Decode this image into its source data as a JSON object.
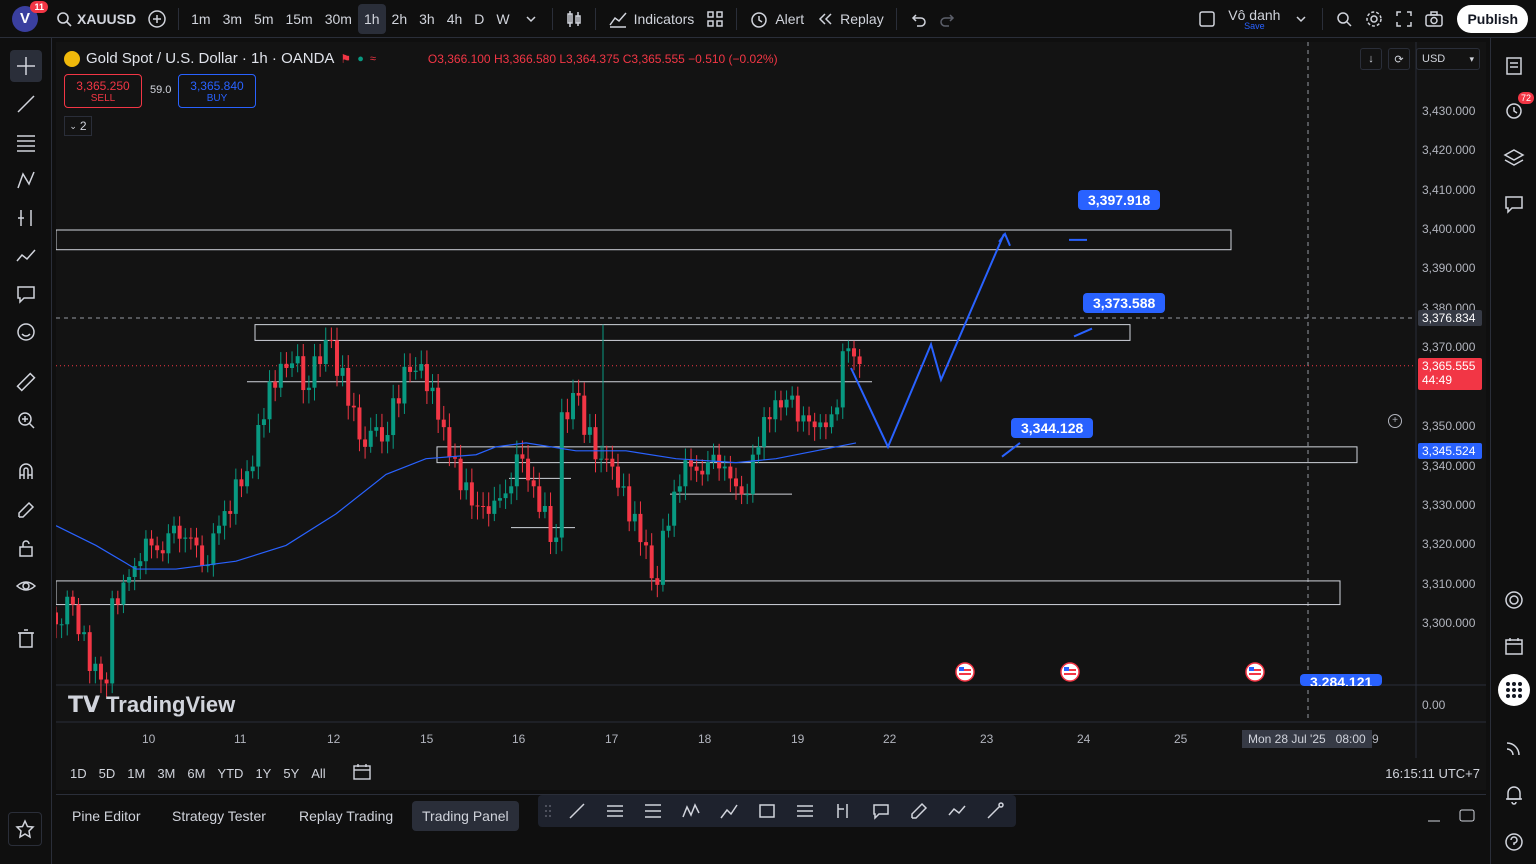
{
  "topbar": {
    "avatar_letter": "V",
    "avatar_badge": "11",
    "symbol": "XAUUSD",
    "timeframes": [
      "1m",
      "3m",
      "5m",
      "15m",
      "30m",
      "1h",
      "2h",
      "3h",
      "4h",
      "D",
      "W"
    ],
    "active_timeframe": "1h",
    "indicators_label": "Indicators",
    "alert_label": "Alert",
    "replay_label": "Replay",
    "layout_name": "Vô danh",
    "layout_status": "Save",
    "publish_label": "Publish"
  },
  "legend": {
    "title": "Gold Spot / U.S. Dollar · 1h · OANDA",
    "open": "O3,366.100",
    "high": "H3,366.580",
    "low": "L3,364.375",
    "close": "C3,365.555",
    "change": "−0.510 (−0.02%)",
    "sell_price": "3,365.250",
    "sell_label": "SELL",
    "buy_price": "3,365.840",
    "buy_label": "BUY",
    "spread": "59.0",
    "collapse_count": "2"
  },
  "price_scale": {
    "currency": "USD",
    "ticks": [
      "3,430.000",
      "3,420.000",
      "3,410.000",
      "3,400.000",
      "3,390.000",
      "3,380.000",
      "3,370.000",
      "3,350.000",
      "3,340.000",
      "3,330.000",
      "3,320.000",
      "3,310.000",
      "3,300.000",
      "0.00"
    ],
    "crosshair_price": "3,376.834",
    "last_price": "3,365.555",
    "countdown": "44:49",
    "ma_price": "3,345.524"
  },
  "time_scale": {
    "ticks": [
      "10",
      "11",
      "12",
      "15",
      "16",
      "17",
      "18",
      "19",
      "22",
      "23",
      "24",
      "25",
      "9"
    ],
    "crosshair_time": "Mon 28 Jul '25   08:00"
  },
  "callouts": {
    "target_high": "3,397.918",
    "target_mid": "3,373.588",
    "support": "3,344.128",
    "bottom": "3,284.121"
  },
  "watermark": "TradingView",
  "periods": [
    "1D",
    "5D",
    "1M",
    "3M",
    "6M",
    "YTD",
    "1Y",
    "5Y",
    "All"
  ],
  "clock": "16:15:11 UTC+7",
  "bottom_tabs": [
    "Pine Editor",
    "Strategy Tester",
    "Replay Trading",
    "Trading Panel"
  ],
  "active_bottom_tab": "Trading Panel",
  "right_badge": "72",
  "colors": {
    "up": "#089981",
    "down": "#f23645",
    "accent": "#2962ff",
    "ma": "#2962ff"
  },
  "chart_data": {
    "type": "candlestick",
    "symbol": "XAUUSD",
    "interval": "1h",
    "ylim": [
      3295,
      3435
    ],
    "zones": [
      {
        "from": 3395,
        "to": 3400
      },
      {
        "from": 3372,
        "to": 3376
      },
      {
        "from": 3341,
        "to": 3345
      },
      {
        "from": 3305,
        "to": 3311
      }
    ],
    "close_path": [
      3300,
      3305,
      3298,
      3290,
      3285,
      3305,
      3312,
      3316,
      3320,
      3318,
      3325,
      3322,
      3320,
      3315,
      3325,
      3328,
      3335,
      3340,
      3352,
      3360,
      3365,
      3368,
      3360,
      3366,
      3372,
      3365,
      3355,
      3345,
      3350,
      3348,
      3356,
      3364,
      3366,
      3360,
      3350,
      3342,
      3336,
      3330,
      3328,
      3332,
      3335,
      3342,
      3335,
      3330,
      3322,
      3352,
      3358,
      3350,
      3342,
      3340,
      3335,
      3328,
      3320,
      3310,
      3325,
      3335,
      3340,
      3338,
      3343,
      3340,
      3335,
      3333,
      3345,
      3352,
      3355,
      3358,
      3353,
      3350,
      3350,
      3355,
      3370,
      3366
    ]
  }
}
